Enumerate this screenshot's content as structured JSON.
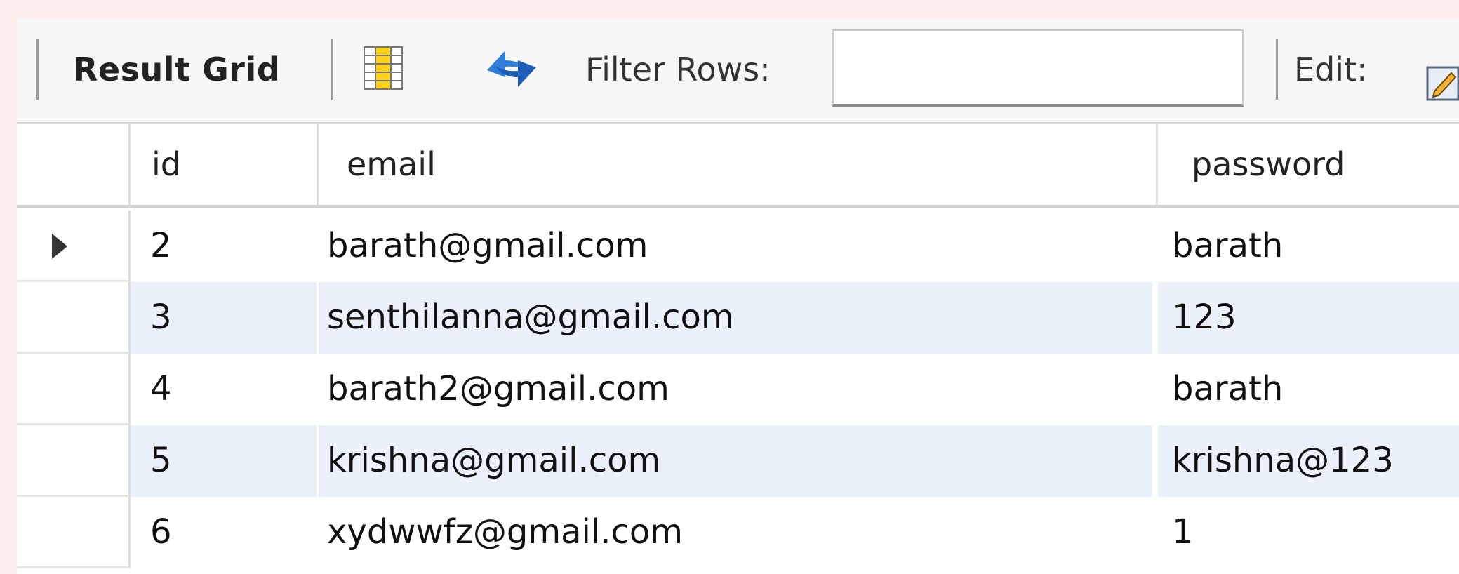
{
  "toolbar": {
    "result_grid_label": "Result Grid",
    "filter_label": "Filter Rows:",
    "filter_value": "",
    "edit_label": "Edit:",
    "icons": [
      "grid-layout-icon",
      "refresh-icon",
      "edit-icon"
    ]
  },
  "columns": [
    "id",
    "email",
    "password"
  ],
  "rows": [
    {
      "id": "2",
      "email": "barath@gmail.com",
      "password": "barath",
      "current": true
    },
    {
      "id": "3",
      "email": "senthilanna@gmail.com",
      "password": "123",
      "current": false
    },
    {
      "id": "4",
      "email": "barath2@gmail.com",
      "password": "barath",
      "current": false
    },
    {
      "id": "5",
      "email": "krishna@gmail.com",
      "password": "krishna@123",
      "current": false
    },
    {
      "id": "6",
      "email": "xydwwfz@gmail.com",
      "password": "1",
      "current": false
    }
  ],
  "colors": {
    "alt_row": "#eaf1fb",
    "toolbar_bg": "#f7f7f7",
    "page_bg": "#fdeeee"
  }
}
